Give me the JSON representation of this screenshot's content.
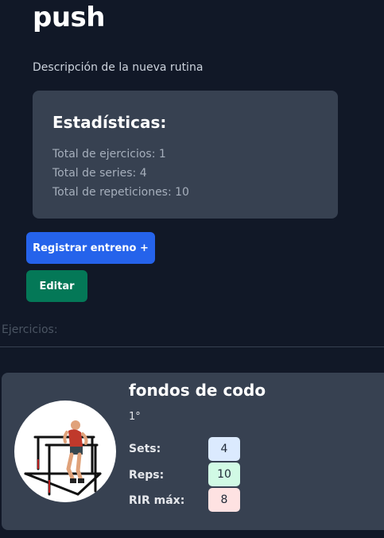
{
  "routine": {
    "title": "push",
    "description": "Descripción de la nueva rutina"
  },
  "stats": {
    "heading": "Estadísticas:",
    "total_exercises": "Total de ejercicios: 1",
    "total_series": "Total de series: 4",
    "total_reps": "Total de repeticiones: 10"
  },
  "actions": {
    "register_label": "Registrar entreno +",
    "edit_label": "Editar"
  },
  "exercises_section": {
    "label": "Ejercicios:"
  },
  "exercises": [
    {
      "name": "fondos de codo",
      "order": "1°",
      "image_icon": "dips-exercise-illustration",
      "sets_label": "Sets:",
      "sets": "4",
      "reps_label": "Reps:",
      "reps": "10",
      "rir_label": "RIR máx:",
      "rir": "8"
    }
  ],
  "colors": {
    "background": "#111827",
    "card": "#374151",
    "primary_button": "#2563eb",
    "edit_button": "#047857",
    "sets_badge": "#dbeafe",
    "reps_badge": "#d1fae5",
    "rir_badge": "#fee2e2"
  }
}
